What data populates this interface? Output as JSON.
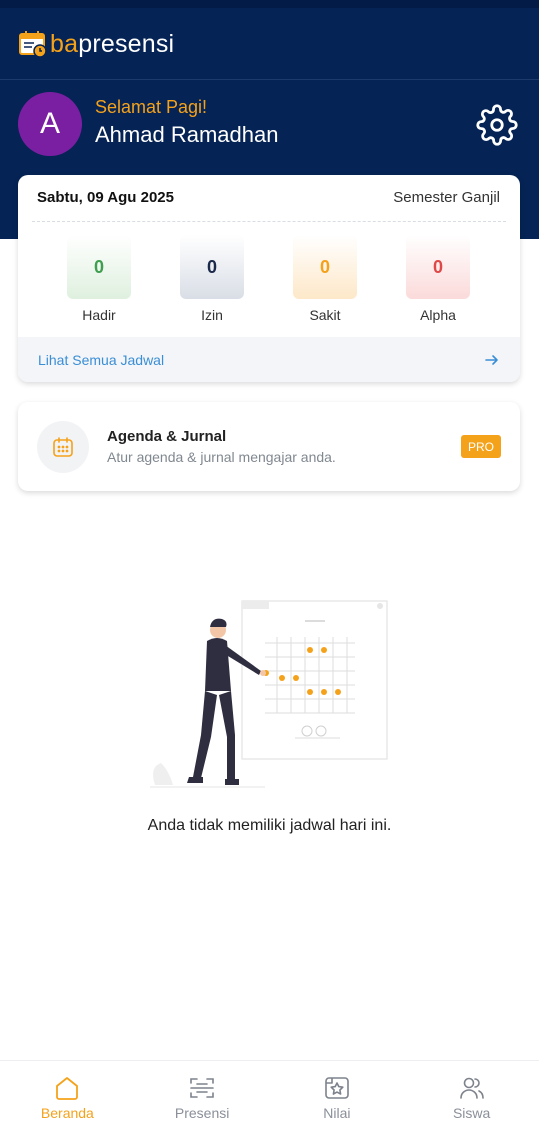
{
  "app": {
    "logo_part1": "ba",
    "logo_part2": "presensi"
  },
  "header": {
    "avatar_initial": "A",
    "greeting": "Selamat Pagi!",
    "user_name": "Ahmad Ramadhan",
    "settings_icon": "gear-icon"
  },
  "attendance": {
    "date": "Sabtu, 09 Agu 2025",
    "semester": "Semester Ganjil",
    "stats": [
      {
        "label": "Hadir",
        "value": "0",
        "color": "#3f9e4f"
      },
      {
        "label": "Izin",
        "value": "0",
        "color": "#1b2a4a"
      },
      {
        "label": "Sakit",
        "value": "0",
        "color": "#f5a21b"
      },
      {
        "label": "Alpha",
        "value": "0",
        "color": "#e04848"
      }
    ],
    "view_all": "Lihat Semua Jadwal"
  },
  "agenda": {
    "title": "Agenda & Jurnal",
    "subtitle": "Atur agenda & jurnal mengajar anda.",
    "badge": "PRO"
  },
  "empty_state": {
    "message": "Anda tidak memiliki jadwal hari ini."
  },
  "bottom_nav": [
    {
      "label": "Beranda",
      "icon": "home-icon",
      "active": true
    },
    {
      "label": "Presensi",
      "icon": "scan-icon",
      "active": false
    },
    {
      "label": "Nilai",
      "icon": "star-tab-icon",
      "active": false
    },
    {
      "label": "Siswa",
      "icon": "users-icon",
      "active": false
    }
  ],
  "colors": {
    "header": "#052354",
    "accent": "#f5a21b",
    "link": "#3a8ed6"
  }
}
